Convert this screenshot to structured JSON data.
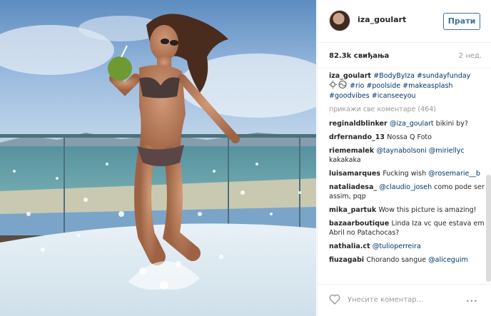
{
  "post": {
    "photo_icon": "photo-of-woman-with-coconut-splashing-water"
  },
  "header": {
    "username": "iza_goulart",
    "follow_label": "Прати"
  },
  "meta": {
    "likes": "82.3k свиђања",
    "time": "2 нед."
  },
  "caption": {
    "user": "iza_goulart",
    "parts": [
      "#BodyByIza",
      "#sundayfunday",
      "#rio",
      "#poolside",
      "#makeasplash",
      "#goodvibes",
      "#icanseeyou"
    ]
  },
  "load_more": "прикажи све коментаре (464)",
  "comments": [
    {
      "user": "reginaldblinker",
      "mention": "@iza_goulart",
      "text": " bikini by?"
    },
    {
      "user": "drfernando_13",
      "mention": "",
      "text": "Nossa Q Foto"
    },
    {
      "user": "riememalek",
      "mention": "@taynabolsoni @miriellyc",
      "text": " kakakaka"
    },
    {
      "user": "luisamarques",
      "mention": "",
      "text": "Fucking wish ",
      "mention2": "@rosemarie__b"
    },
    {
      "user": "nataliadesa_",
      "mention": "@claudio_joseh",
      "text": " como pode ser assim, pqp"
    },
    {
      "user": "mika_partuk",
      "mention": "",
      "text": "Wow this picture is amazing!"
    },
    {
      "user": "bazaarboutique",
      "mention": "",
      "text": "Linda Iza vc que estava em Abril no Patachocas?"
    },
    {
      "user": "nathalia.ct",
      "mention": "@tulioperreira",
      "text": ""
    },
    {
      "user": "fiuzagabi",
      "mention": "",
      "text": "Chorando sangue ",
      "mention2": "@aliceguim"
    }
  ],
  "footer": {
    "heart_icon": "heart-icon",
    "placeholder": "Унесите коментар...",
    "more_label": "..."
  }
}
